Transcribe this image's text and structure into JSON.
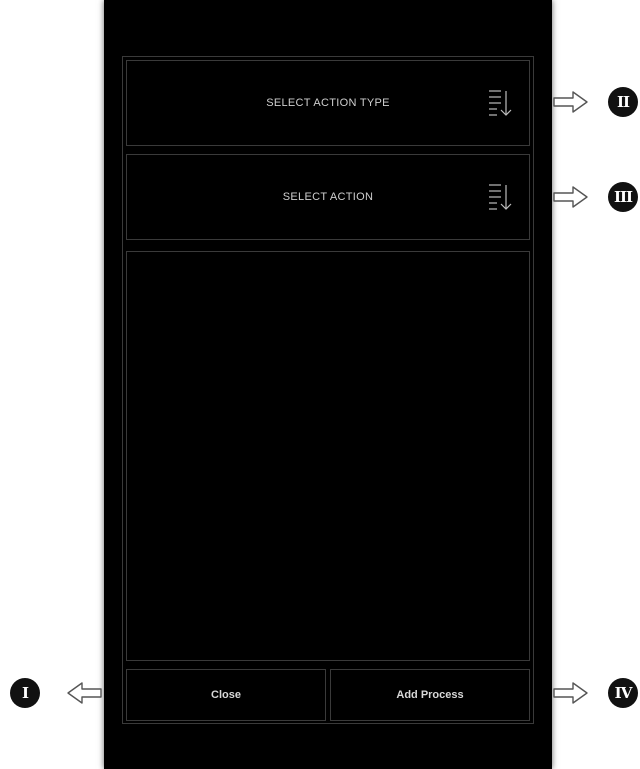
{
  "dialog": {
    "action_type_dropdown": {
      "label": "SELECT ACTION TYPE",
      "icon": "sort-list-icon"
    },
    "action_dropdown": {
      "label": "SELECT ACTION",
      "icon": "sort-list-icon"
    },
    "buttons": {
      "close_label": "Close",
      "add_process_label": "Add Process"
    }
  },
  "callouts": {
    "i": "I",
    "ii": "II",
    "iii": "III",
    "iv": "IV"
  },
  "colors": {
    "background": "#000000",
    "border": "#3a3a3a",
    "text": "#cfcfcf",
    "badge": "#111111"
  }
}
